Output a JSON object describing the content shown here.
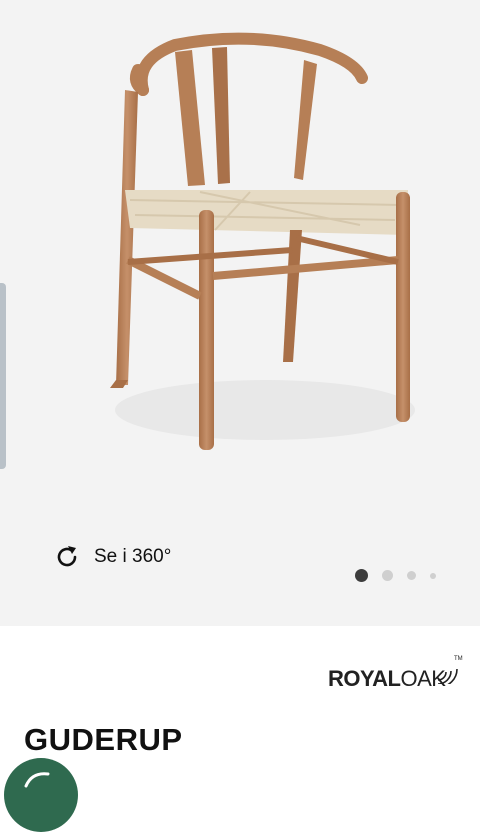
{
  "gallery": {
    "view360_label": "Se i 360°",
    "image_alt": "Guderup stol",
    "dots": [
      {
        "active": true
      },
      {
        "active": false
      },
      {
        "active": false
      },
      {
        "active": false
      }
    ]
  },
  "brand": {
    "name_bold": "ROYAL",
    "name_light": "OAK",
    "trademark": "TM"
  },
  "product": {
    "title": "GUDERUP"
  },
  "colors": {
    "gallery_bg": "#f3f3f3",
    "wood": "#b67f56",
    "seat_cord": "#e6dbc5",
    "chat_green": "#2f6a4f"
  },
  "icons": {
    "view360": "refresh-icon",
    "chat": "chat-icon"
  }
}
